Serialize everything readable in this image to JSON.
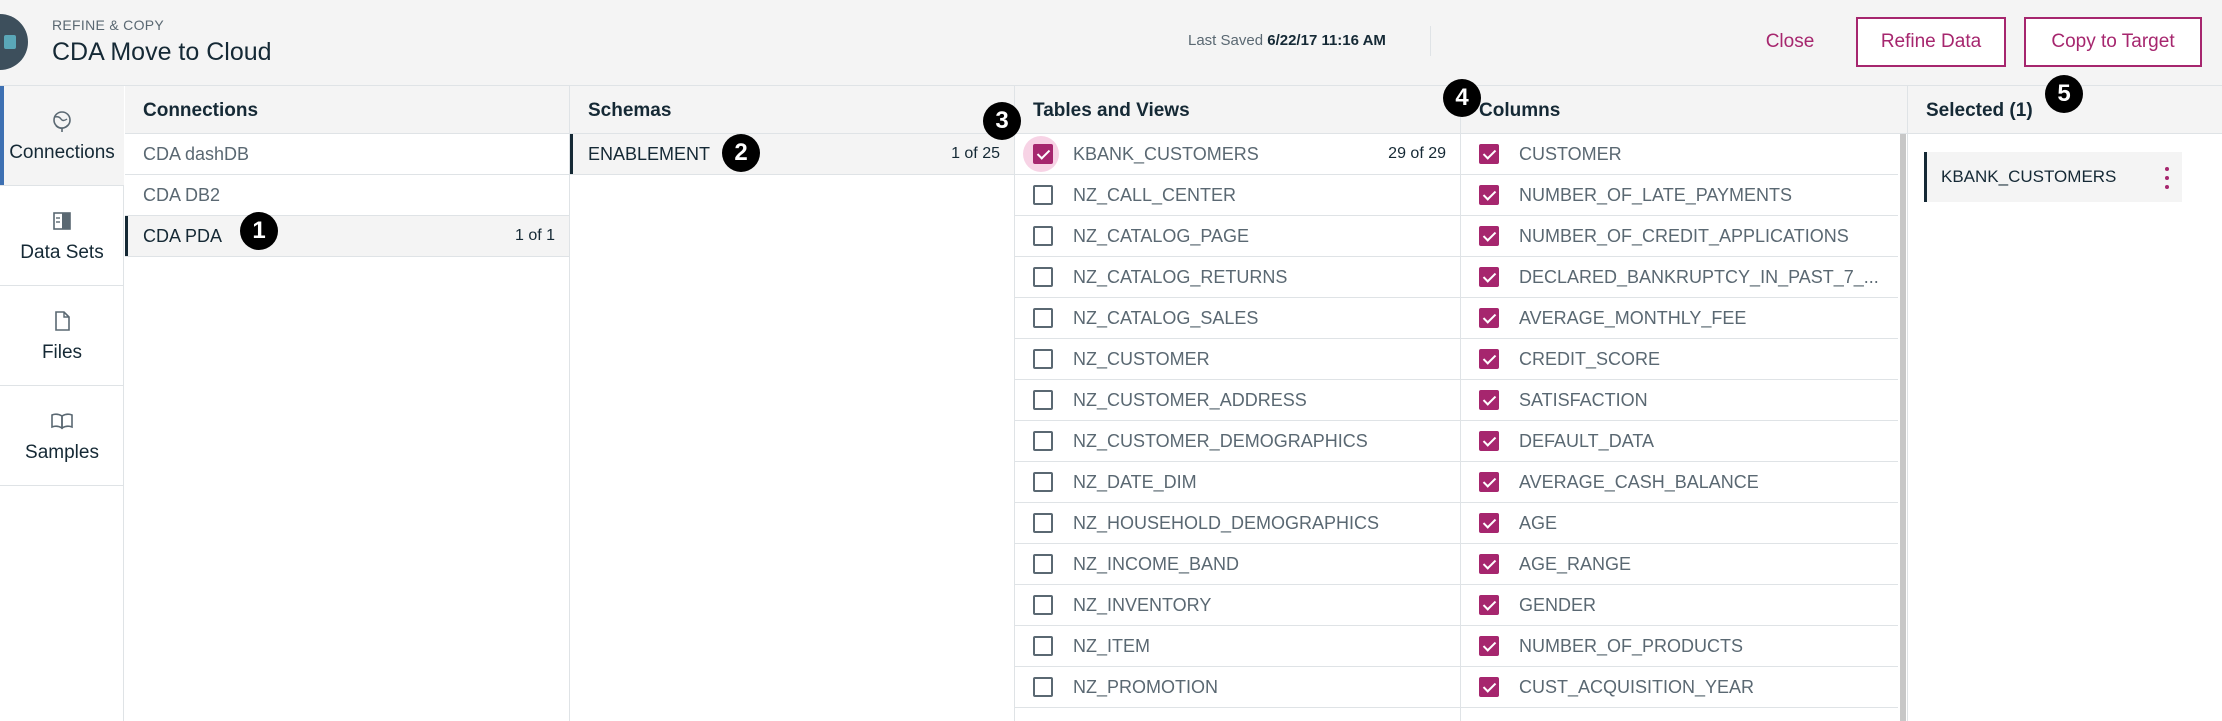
{
  "header": {
    "kicker": "REFINE & COPY",
    "title": "CDA Move to Cloud",
    "last_saved_label": "Last Saved",
    "last_saved_value": "6/22/17 11:16 AM",
    "close_label": "Close",
    "refine_label": "Refine Data",
    "copy_label": "Copy to Target"
  },
  "nav": {
    "items": [
      {
        "label": "Connections",
        "icon": "globe-icon"
      },
      {
        "label": "Data Sets",
        "icon": "dataset-icon"
      },
      {
        "label": "Files",
        "icon": "file-icon"
      },
      {
        "label": "Samples",
        "icon": "book-icon"
      }
    ]
  },
  "connections": {
    "title": "Connections",
    "items": [
      {
        "label": "CDA dashDB"
      },
      {
        "label": "CDA DB2"
      },
      {
        "label": "CDA PDA",
        "count": "1 of 1"
      }
    ]
  },
  "schemas": {
    "title": "Schemas",
    "items": [
      {
        "label": "ENABLEMENT",
        "count": "1 of 25"
      }
    ]
  },
  "tables": {
    "title": "Tables and Views",
    "items": [
      {
        "label": "KBANK_CUSTOMERS",
        "count": "29 of 29",
        "checked": true
      },
      {
        "label": "NZ_CALL_CENTER",
        "checked": false
      },
      {
        "label": "NZ_CATALOG_PAGE",
        "checked": false
      },
      {
        "label": "NZ_CATALOG_RETURNS",
        "checked": false
      },
      {
        "label": "NZ_CATALOG_SALES",
        "checked": false
      },
      {
        "label": "NZ_CUSTOMER",
        "checked": false
      },
      {
        "label": "NZ_CUSTOMER_ADDRESS",
        "checked": false
      },
      {
        "label": "NZ_CUSTOMER_DEMOGRAPHICS",
        "checked": false
      },
      {
        "label": "NZ_DATE_DIM",
        "checked": false
      },
      {
        "label": "NZ_HOUSEHOLD_DEMOGRAPHICS",
        "checked": false
      },
      {
        "label": "NZ_INCOME_BAND",
        "checked": false
      },
      {
        "label": "NZ_INVENTORY",
        "checked": false
      },
      {
        "label": "NZ_ITEM",
        "checked": false
      },
      {
        "label": "NZ_PROMOTION",
        "checked": false
      }
    ]
  },
  "columns": {
    "title": "Columns",
    "items": [
      {
        "label": "CUSTOMER",
        "checked": true
      },
      {
        "label": "NUMBER_OF_LATE_PAYMENTS",
        "checked": true
      },
      {
        "label": "NUMBER_OF_CREDIT_APPLICATIONS",
        "checked": true
      },
      {
        "label": "DECLARED_BANKRUPTCY_IN_PAST_7_...",
        "checked": true
      },
      {
        "label": "AVERAGE_MONTHLY_FEE",
        "checked": true
      },
      {
        "label": "CREDIT_SCORE",
        "checked": true
      },
      {
        "label": "SATISFACTION",
        "checked": true
      },
      {
        "label": "DEFAULT_DATA",
        "checked": true
      },
      {
        "label": "AVERAGE_CASH_BALANCE",
        "checked": true
      },
      {
        "label": "AGE",
        "checked": true
      },
      {
        "label": "AGE_RANGE",
        "checked": true
      },
      {
        "label": "GENDER",
        "checked": true
      },
      {
        "label": "NUMBER_OF_PRODUCTS",
        "checked": true
      },
      {
        "label": "CUST_ACQUISITION_YEAR",
        "checked": true
      }
    ]
  },
  "selected": {
    "title": "Selected (1)",
    "items": [
      {
        "label": "KBANK_CUSTOMERS"
      }
    ]
  },
  "steps": [
    "1",
    "2",
    "3",
    "4",
    "5"
  ],
  "colors": {
    "accent": "#a6266e",
    "text": "#152935",
    "muted": "#5a6872",
    "panel_header": "#f4f4f4"
  }
}
